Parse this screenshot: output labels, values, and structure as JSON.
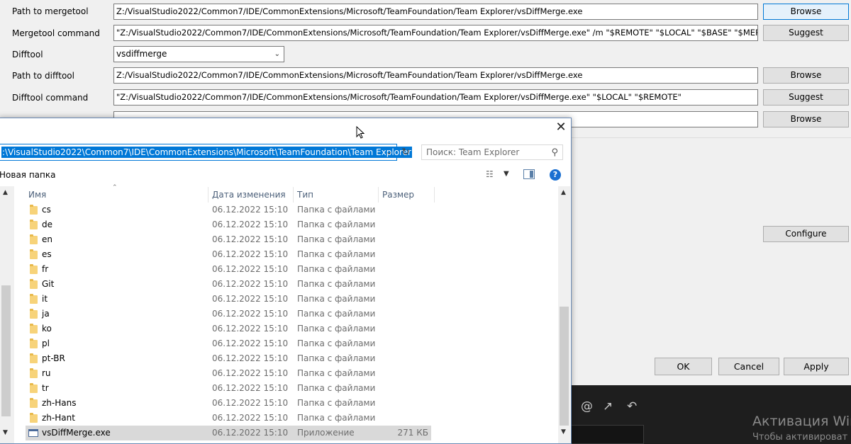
{
  "settings": {
    "mergetool_path": {
      "label": "Path to mergetool",
      "value": "Z:/VisualStudio2022/Common7/IDE/CommonExtensions/Microsoft/TeamFoundation/Team Explorer/vsDiffMerge.exe",
      "button": "Browse"
    },
    "mergetool_command": {
      "label": "Mergetool command",
      "value": "\"Z:/VisualStudio2022/Common7/IDE/CommonExtensions/Microsoft/TeamFoundation/Team Explorer/vsDiffMerge.exe\" /m \"$REMOTE\" \"$LOCAL\" \"$BASE\" \"$MERGED\"",
      "button": "Suggest"
    },
    "difftool": {
      "label": "Difftool",
      "value": "vsdiffmerge"
    },
    "difftool_path": {
      "label": "Path to difftool",
      "value": "Z:/VisualStudio2022/Common7/IDE/CommonExtensions/Microsoft/TeamFoundation/Team Explorer/vsDiffMerge.exe",
      "button": "Browse"
    },
    "difftool_command": {
      "label": "Difftool command",
      "value": "\"Z:/VisualStudio2022/Common7/IDE/CommonExtensions/Microsoft/TeamFoundation/Team Explorer/vsDiffMerge.exe\" \"$LOCAL\" \"$REMOTE\"",
      "button": "Suggest"
    },
    "commit_template": {
      "button": "Browse"
    },
    "configure_button": "Configure",
    "ok_button": "OK",
    "cancel_button": "Cancel",
    "apply_button": "Apply"
  },
  "watermark": {
    "line1": "Активация Win",
    "line2": "Чтобы активироват"
  },
  "file_dialog": {
    "address": ":\\VisualStudio2022\\Common7\\IDE\\CommonExtensions\\Microsoft\\TeamFoundation\\Team Explorer",
    "search_placeholder": "Поиск: Team Explorer",
    "new_folder": "Новая папка",
    "columns": {
      "name": "Имя",
      "date": "Дата изменения",
      "type": "Тип",
      "size": "Размер"
    },
    "files": [
      {
        "name": "cs",
        "date": "06.12.2022 15:10",
        "type": "Папка с файлами",
        "size": ""
      },
      {
        "name": "de",
        "date": "06.12.2022 15:10",
        "type": "Папка с файлами",
        "size": ""
      },
      {
        "name": "en",
        "date": "06.12.2022 15:10",
        "type": "Папка с файлами",
        "size": ""
      },
      {
        "name": "es",
        "date": "06.12.2022 15:10",
        "type": "Папка с файлами",
        "size": ""
      },
      {
        "name": "fr",
        "date": "06.12.2022 15:10",
        "type": "Папка с файлами",
        "size": ""
      },
      {
        "name": "Git",
        "date": "06.12.2022 15:10",
        "type": "Папка с файлами",
        "size": ""
      },
      {
        "name": "it",
        "date": "06.12.2022 15:10",
        "type": "Папка с файлами",
        "size": ""
      },
      {
        "name": "ja",
        "date": "06.12.2022 15:10",
        "type": "Папка с файлами",
        "size": ""
      },
      {
        "name": "ko",
        "date": "06.12.2022 15:10",
        "type": "Папка с файлами",
        "size": ""
      },
      {
        "name": "pl",
        "date": "06.12.2022 15:10",
        "type": "Папка с файлами",
        "size": ""
      },
      {
        "name": "pt-BR",
        "date": "06.12.2022 15:10",
        "type": "Папка с файлами",
        "size": ""
      },
      {
        "name": "ru",
        "date": "06.12.2022 15:10",
        "type": "Папка с файлами",
        "size": ""
      },
      {
        "name": "tr",
        "date": "06.12.2022 15:10",
        "type": "Папка с файлами",
        "size": ""
      },
      {
        "name": "zh-Hans",
        "date": "06.12.2022 15:10",
        "type": "Папка с файлами",
        "size": ""
      },
      {
        "name": "zh-Hant",
        "date": "06.12.2022 15:10",
        "type": "Папка с файлами",
        "size": ""
      },
      {
        "name": "vsDiffMerge.exe",
        "date": "06.12.2022 15:10",
        "type": "Приложение",
        "size": "271 КБ"
      }
    ]
  }
}
